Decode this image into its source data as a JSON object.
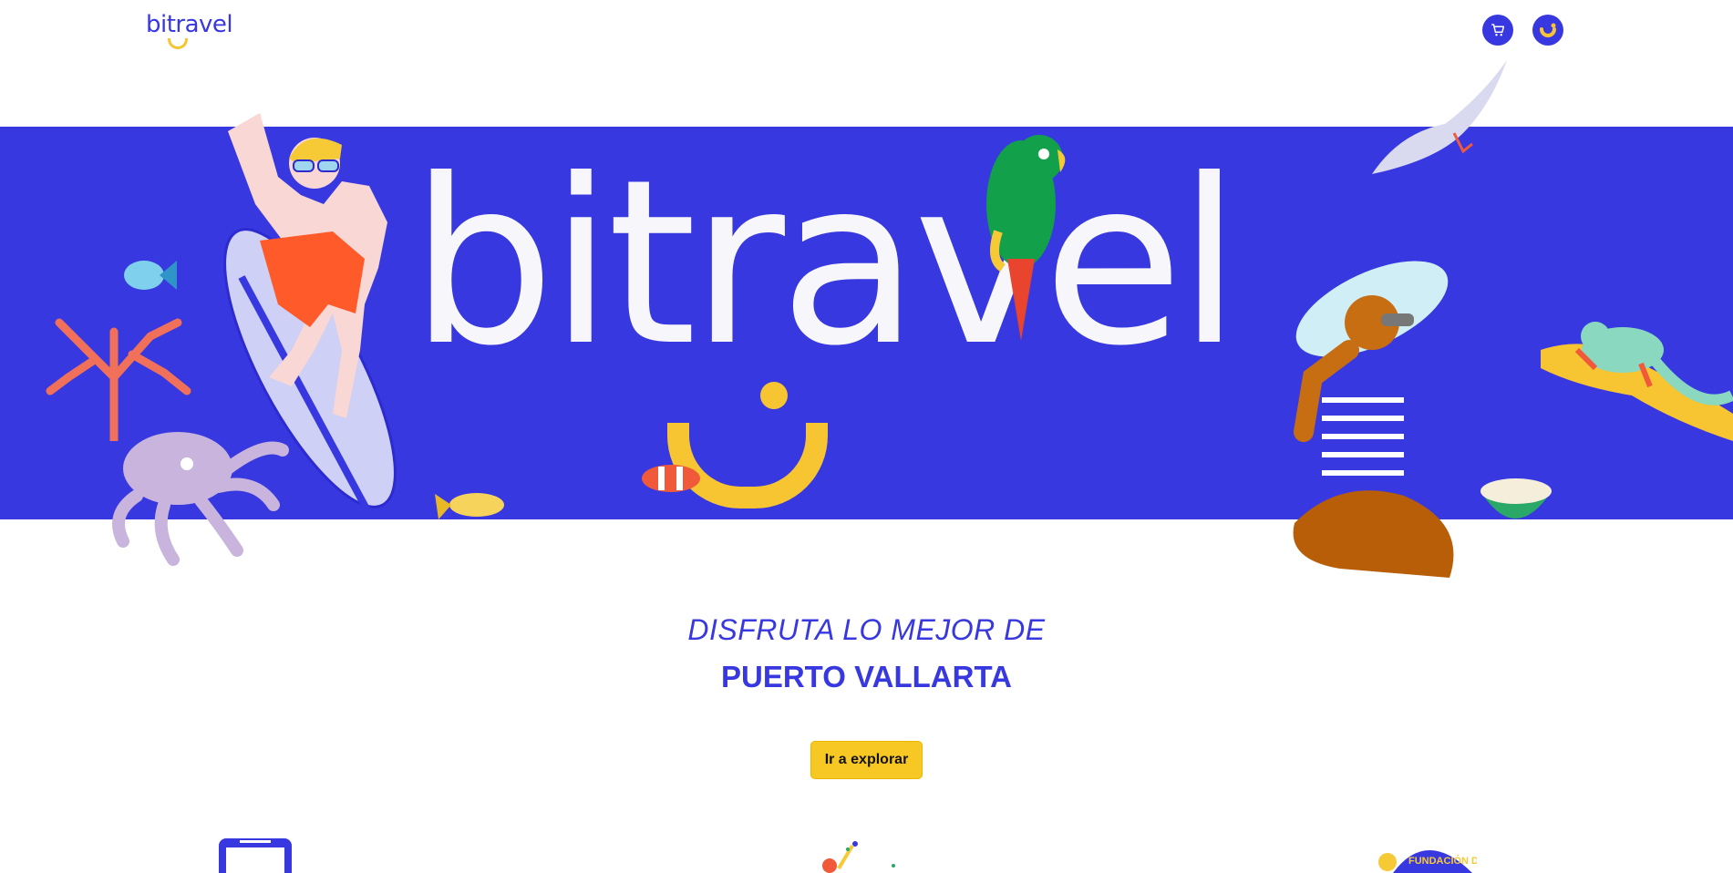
{
  "brand": {
    "logo_text": "bitravel",
    "hero_text": "bitravel"
  },
  "header": {
    "icons": [
      "cart-icon",
      "smile-profile-icon"
    ]
  },
  "hero": {
    "tagline_line1": "DISFRUTA LO MEJOR DE",
    "tagline_line2": "PUERTO VALLARTA",
    "cta_label": "Ir a explorar"
  },
  "seal": {
    "text": "FUNDACIÓN DEL P"
  },
  "colors": {
    "brand_blue": "#3838e0",
    "accent_yellow": "#f7c531",
    "background": "#ffffff"
  }
}
